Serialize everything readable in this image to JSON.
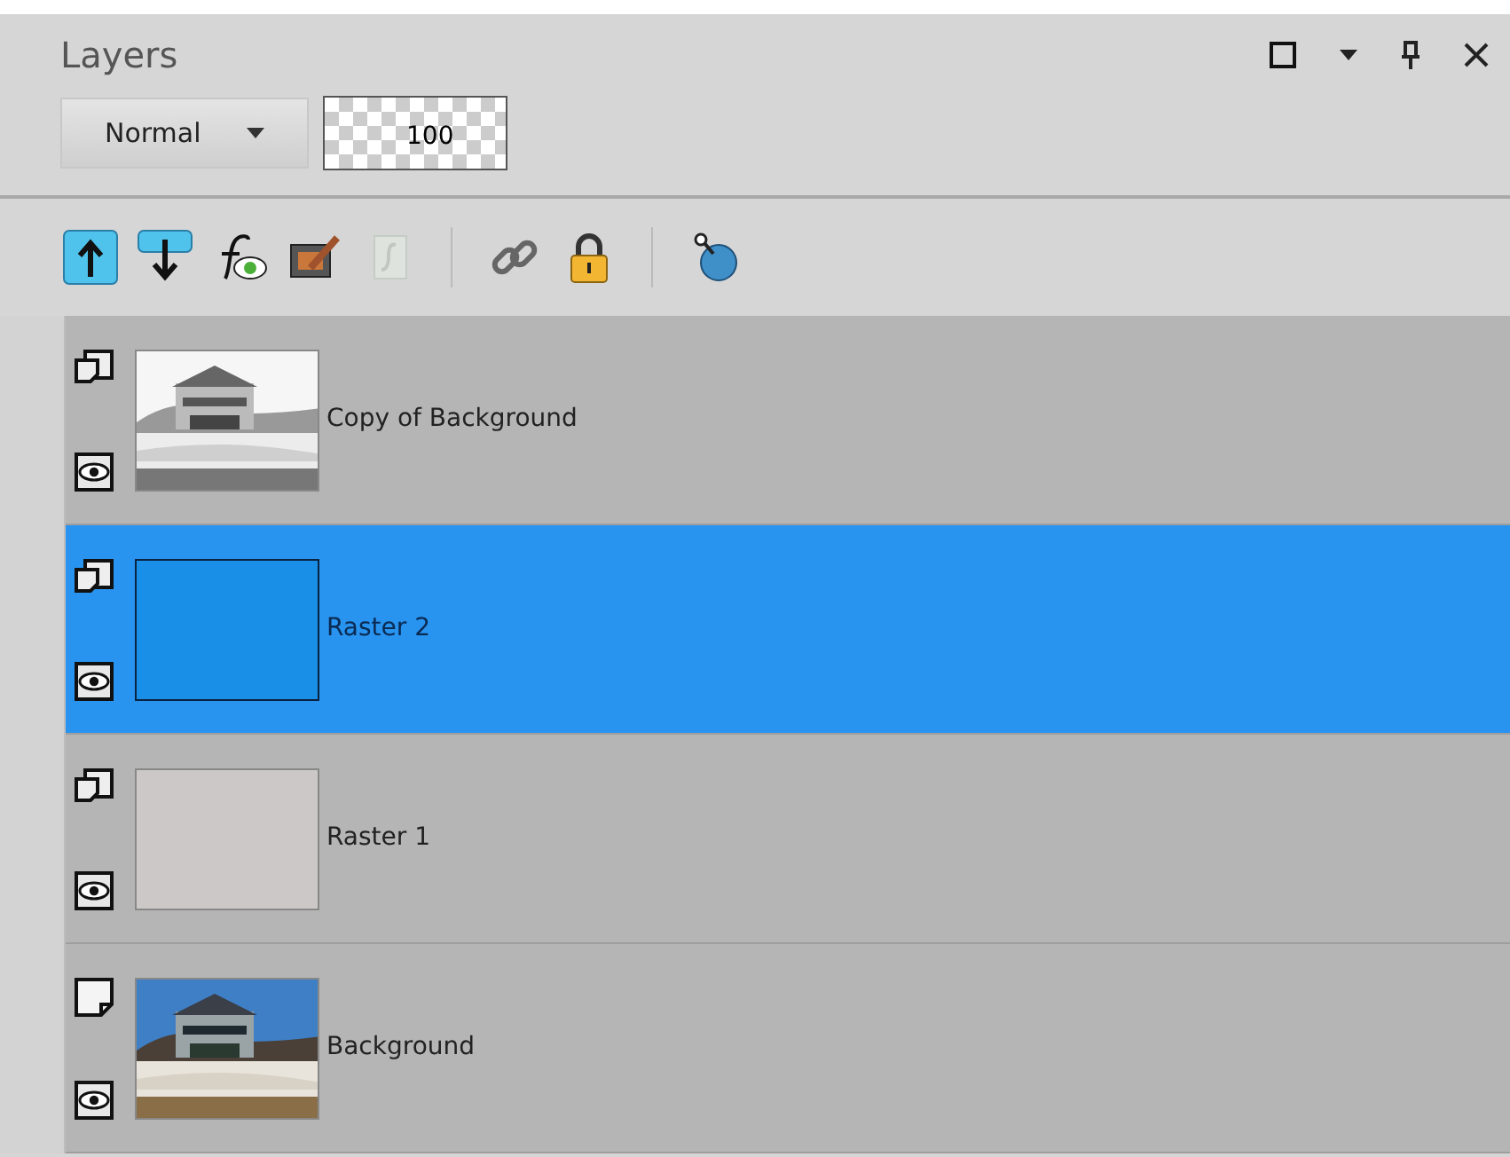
{
  "panel": {
    "title": "Layers"
  },
  "blend_mode": {
    "value": "Normal"
  },
  "opacity": {
    "value": "100"
  },
  "toolbar": [
    {
      "kind": "move-up",
      "disabled": false
    },
    {
      "kind": "move-down",
      "disabled": false
    },
    {
      "kind": "effects",
      "disabled": false
    },
    {
      "kind": "edit",
      "disabled": false
    },
    {
      "kind": "script",
      "disabled": true
    },
    {
      "kind": "link",
      "disabled": false
    },
    {
      "kind": "lock",
      "disabled": false
    },
    {
      "kind": "mask",
      "disabled": false
    }
  ],
  "layers": [
    {
      "name": "Copy of Background",
      "kind": "raster",
      "visible": true,
      "selected": false
    },
    {
      "name": "Raster 2",
      "kind": "raster",
      "visible": true,
      "selected": true,
      "thumbnail": {
        "kind": "fill",
        "color": "#1a8fe8"
      }
    },
    {
      "name": "Raster 1",
      "kind": "raster",
      "visible": true,
      "selected": false,
      "thumbnail": {
        "kind": "fill",
        "color": "#cdc8c8"
      }
    },
    {
      "name": "Background",
      "kind": "background",
      "visible": true,
      "selected": false
    }
  ]
}
